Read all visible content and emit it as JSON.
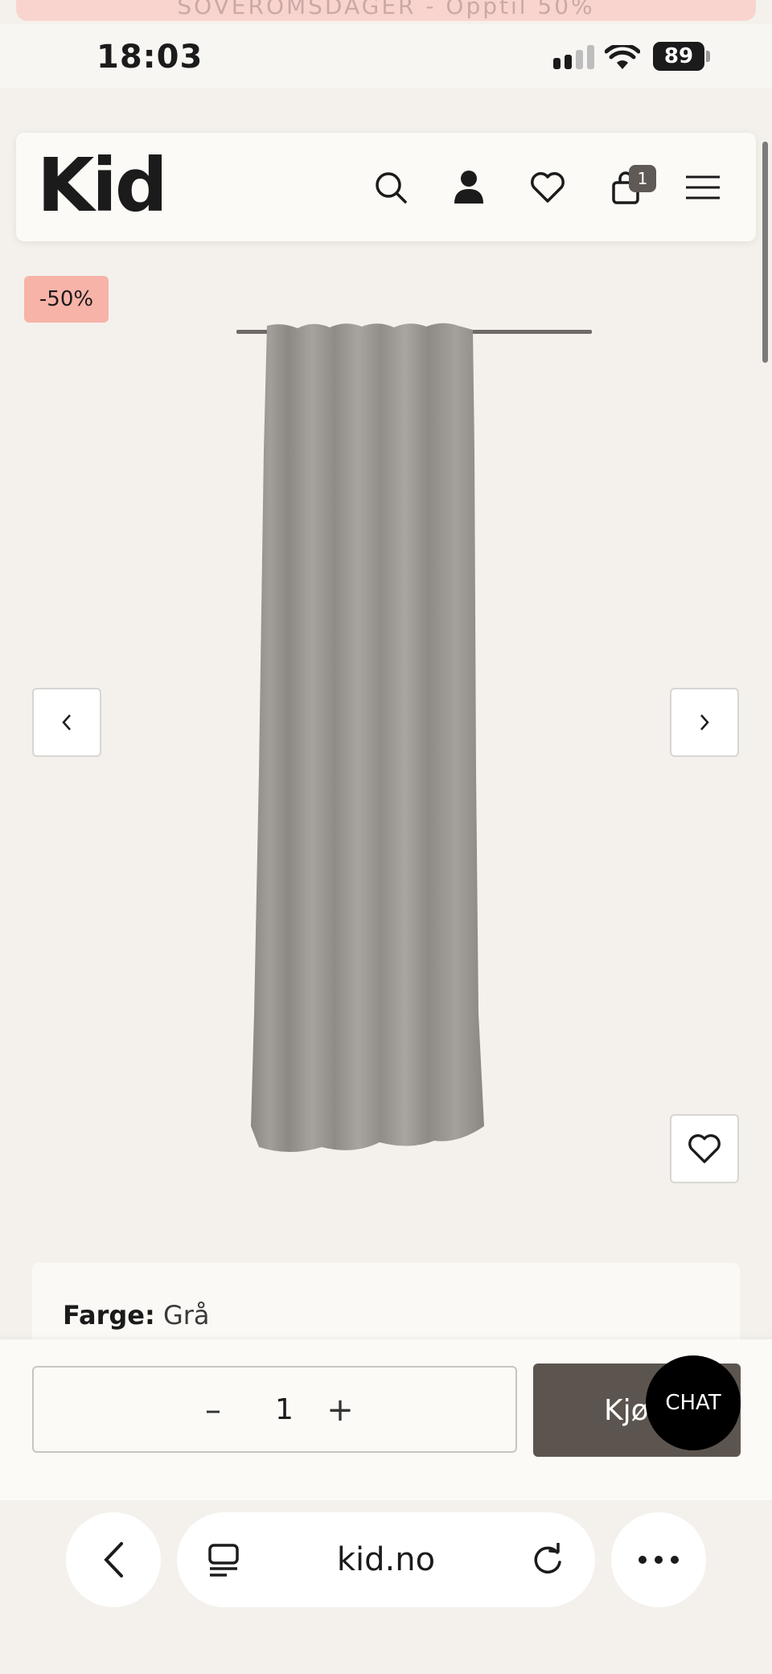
{
  "banner": {
    "text": "SOVEROMSDAGER - Opptil 50%"
  },
  "status_bar": {
    "time": "18:03",
    "battery": "89"
  },
  "header": {
    "logo": "Kid",
    "icons": [
      "search-icon",
      "user-icon",
      "heart-icon",
      "cart-icon",
      "menu-icon"
    ],
    "cart_count": "1"
  },
  "product": {
    "discount_badge": "-50%",
    "image": "grey-curtain"
  },
  "options": {
    "color_label": "Farge:",
    "color_value": "Grå"
  },
  "purchase": {
    "quantity": "1",
    "minus": "–",
    "plus": "+",
    "buy_label": "Kjøp",
    "chat_label": "CHAT"
  },
  "browser": {
    "url": "kid.no"
  },
  "colors": {
    "background": "#f4f1ec",
    "badge": "#f7b3a8",
    "buy_button": "#5c554f",
    "chat": "#000000"
  }
}
